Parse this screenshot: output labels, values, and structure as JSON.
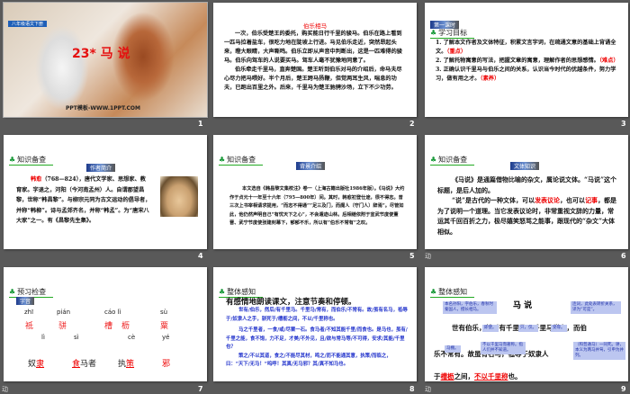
{
  "slides": [
    {
      "number": "1",
      "badge": "八年级语文下册",
      "title": "23* 马  说",
      "watermark": "PPT模板-WWW.1PPT.COM"
    },
    {
      "number": "2",
      "title": "伯乐相马",
      "paragraphs": [
        "一次，伯乐受楚王的委托，购买能日行千里的骏马。伯乐在路上看到一匹马拉着盐车，很吃力地在陡坡上行进。马见伯乐走近，突然昂起头来，瞪大眼睛，大声嘶鸣。伯乐立即从声音中判断出，这是一匹难得的骏马。伯乐向驾车的人说要买马。驾车人毫不犹豫地同意了。",
        "伯乐牵走千里马，直奔楚国。楚王听到伯乐对马的介绍后，命马夫尽心尽力把马喂好。半个月后，楚王跨马扬鞭，但觉两耳生风，喘息的功夫，已跑出百里之外。后来，千里马为楚王驰骋沙场，立下不少功劳。"
      ]
    },
    {
      "number": "3",
      "badge": "第一课时",
      "section": "学习目标",
      "items": [
        {
          "text": "1. 了解本文作者及文体特征，积累文言字词，在疏通文意的基础上背诵全文。",
          "tag": "（重点）"
        },
        {
          "text": "2. 了解托物寓意的写法，把握文章的寓意，理解作者的思想感情。",
          "tag": "（难点）"
        },
        {
          "text": "3. 正确认识千里马与伯乐之间的关系，认识当今时代的优越条件，努力学习，做有用之才。",
          "tag": "（素养）"
        }
      ]
    },
    {
      "number": "4",
      "section": "知识备查",
      "badge": "作者简介",
      "name": "韩愈",
      "text": "（768—824），唐代文学家、思想家、教育家。字退之，河阳（今河南孟州）人。自谓郡望昌黎，世称“韩昌黎”。与柳宗元同为古文运动的倡导者，并称“韩柳”。诗与孟郊齐名，并称“韩孟”。为“唐宋八大家”之一。有《昌黎先生集》。"
    },
    {
      "number": "5",
      "section": "知识备查",
      "badge": "背景介绍",
      "text": "本文选自《韩昌黎文集校注》卷一（上海古籍出版社1986年版）。《马说》大约作于贞元十一年至十六年（795—800年）间。其时，韩愈初登仕途，很不得志。曾三次上书宰相请求提用，“而志不得通”“足三及门，而阍人（守门人）辞焉”。尽管如此，他仍然声明自己“有忧天下之心”，不会遁迹山林。后相继依附于宣武节度使董晋、武宁节度使张建封幕下，郁郁不乐，所以有“伯乐不常有”之叹。"
    },
    {
      "number": "6",
      "section": "知识备查",
      "badge": "文体知识",
      "p1": "《马说》是通篇借物比喻的杂文，属论说文体。“马说”这个标题，是后人加的。",
      "p2a": "“说”是古代的一种文体，可以",
      "hl1": "发表议论",
      "p2b": "，也可以",
      "hl2": "记事",
      "p2c": "，都是为了说明一个道理。当它发表议论时，非常重视文辞的力量，常运其千回百折之力，极尽嬉笑怒骂之能事，跟现代的“杂文”大体相似。",
      "anim": "动"
    },
    {
      "number": "7",
      "section": "预习检查",
      "badge": "字音",
      "pinyin1": [
        "zhī",
        "pián",
        "cáo lì",
        "sù"
      ],
      "chars1": [
        "祗",
        "骈",
        "槽",
        "枥",
        "粟"
      ],
      "pinyin2": [
        "lì",
        "sì",
        "cè",
        "yé"
      ],
      "words2": [
        {
          "a": "奴",
          "b": "隶"
        },
        {
          "a": "",
          "b": "食",
          "c": "马者"
        },
        {
          "a": "执",
          "b": "策"
        },
        {
          "a": "",
          "b": "邪"
        }
      ],
      "anim": "动"
    },
    {
      "number": "8",
      "section": "整体感知",
      "heading": "有感情地朗读课文，注意节奏和停顿。",
      "paragraphs": [
        "世有/伯乐，然后/有千里马。千里马/常有，而伯乐/不常有。故/虽有名马，祗辱于/奴隶人之手，骈死于/槽枥之间，不以/千里称也。",
        "马之千里者，一食/或/尽粟一石。食马者/不知其能千里/而食也。是马也，虽有/千里之能，食不饱，力不足，才美/不外见，且/欲与常马等/不可得，安求/其能/千里也？",
        "策之/不以其道，食之/不能尽其材，鸣之/而不能通其意，执策/而临之，曰：“天下/无马！”呜呼！其真/无马邪？其/真不知马也。"
      ]
    },
    {
      "number": "9",
      "section": "整体感知",
      "title": "马   说",
      "line1": "世有伯乐，然后有千里马。千里马常有，而伯",
      "line2": "乐不常有。故虽有名马，祗辱于奴隶人",
      "line3a": "于",
      "line3b": "槽枥",
      "line3c": "之间，",
      "line3d": "不以千里称",
      "line3e": "也。",
      "notes": [
        "本名孙阳，字伯乐，春秋时秦国人，擅长相马。",
        "连词，此处表转折关系，译为“可是”。",
        "即使。",
        "只，仅。",
        "受辱。",
        "马棚。",
        "不以千里马而著称。指人们并不知道。",
        "（和普通马）一同死。骈，本义为两马并驾，引申为并列。"
      ],
      "anim": "动"
    }
  ]
}
